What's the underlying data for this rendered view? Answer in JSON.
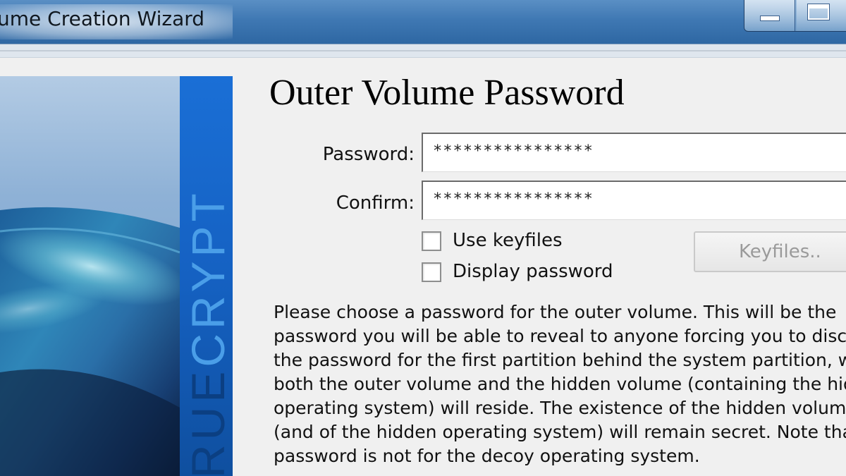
{
  "window": {
    "title": "ume Creation Wizard"
  },
  "banner": {
    "text_part1": "RUE",
    "text_part2": "CRYPT",
    "colors": {
      "stripe": "#1565c8",
      "text_dark": "#0b3f82",
      "text_light": "#4a9ee8"
    }
  },
  "page": {
    "heading": "Outer Volume Password",
    "password_label": "Password:",
    "password_value": "****************",
    "confirm_label": "Confirm:",
    "confirm_value": "****************",
    "use_keyfiles_label": "Use keyfiles",
    "use_keyfiles_checked": false,
    "display_password_label": "Display password",
    "display_password_checked": false,
    "keyfiles_button": "Keyfiles..",
    "keyfiles_button_enabled": false,
    "description_lines": [
      "Please choose a password for the outer volume. This will be the",
      "password you will be able to reveal to anyone forcing you to disclose",
      "the password for the first partition behind the system partition, where",
      "both the outer volume and the hidden volume (containing the hidden",
      "operating system) will reside. The existence of the hidden volume",
      "(and of the hidden operating system) will remain secret. Note that this",
      "password is not for the decoy operating system."
    ]
  }
}
